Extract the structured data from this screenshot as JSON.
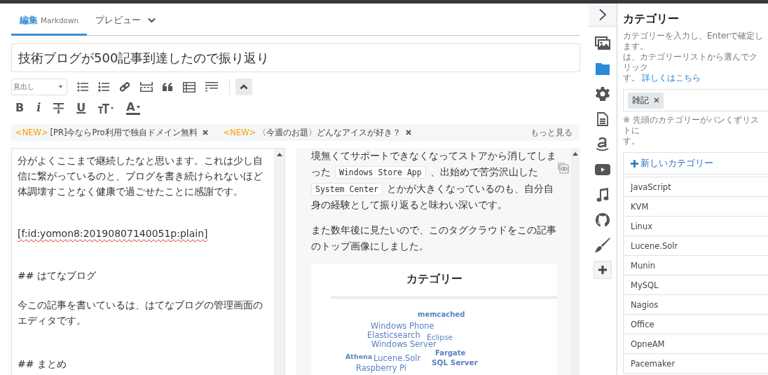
{
  "tabs": [
    {
      "label": "編集",
      "sublabel": "Markdown",
      "selected": true,
      "dropdown": false
    },
    {
      "label": "プレビュー",
      "selected": false,
      "dropdown": true
    }
  ],
  "title_field": {
    "value": "技術ブログが500記事到達したので振り返り"
  },
  "toolbar": {
    "heading_select": {
      "placeholder": "見出し"
    },
    "tools": [
      {
        "kind": "bullet-list"
      },
      {
        "kind": "number-list"
      },
      {
        "kind": "link"
      },
      {
        "kind": "page-break"
      },
      {
        "kind": "quote"
      },
      {
        "kind": "table"
      },
      {
        "kind": "more"
      }
    ],
    "format_buttons": [
      {
        "kind": "bold",
        "glyph": "B"
      },
      {
        "kind": "italic",
        "glyph": "i"
      },
      {
        "kind": "strike"
      },
      {
        "kind": "underline",
        "glyph": "U"
      },
      {
        "kind": "size"
      },
      {
        "kind": "color",
        "glyph": "A"
      }
    ]
  },
  "notices": [
    {
      "badge": "<NEW>",
      "text": "[PR]今ならPro利用で独自ドメイン無料"
    },
    {
      "badge": "<NEW>",
      "text": "〈今週のお題〉どんなアイスが好き？"
    }
  ],
  "more_link": "もっと見る",
  "editor_blocks": [
    {
      "kind": "text",
      "lines": [
        "分がよくここまで継続したなと思います。これは少し自",
        "信に繋がっているのと、ブログを書き続けられないほど",
        "体調壊すことなく健康で過ごせたことに感謝です。"
      ]
    },
    {
      "kind": "misspelled",
      "lines": [
        "[f:id:yomon8:20190807140051p:plain]"
      ]
    },
    {
      "kind": "heading",
      "lines": [
        "## はてなブログ"
      ]
    },
    {
      "kind": "text",
      "lines": [
        "今この記事を書いているは、はてなブログの管理画面の",
        "エディタです。"
      ]
    },
    {
      "kind": "heading",
      "lines": [
        "## まとめ"
      ]
    }
  ],
  "preview_paragraphs": [
    {
      "lines": [
        [
          {
            "kind": "text",
            "text": "境無くてサポートできなくなってストアから消してしま"
          }
        ],
        [
          {
            "kind": "text",
            "text": "った"
          },
          {
            "kind": "code",
            "text": "Windows Store App"
          },
          {
            "kind": "text",
            "text": "、出始めで苦労沢山した"
          }
        ],
        [
          {
            "kind": "code",
            "text": "System Center"
          },
          {
            "kind": "text",
            "text": "とかが大きくなっているのも、自分自"
          }
        ],
        [
          {
            "kind": "text",
            "text": "身の経験として振り返ると味わい深いです。"
          }
        ]
      ]
    },
    {
      "lines": [
        [
          {
            "kind": "text",
            "text": "また数年後に見たいので、このタグクラウドをこの記事"
          }
        ],
        [
          {
            "kind": "text",
            "text": "のトップ画像にしました。"
          }
        ]
      ]
    }
  ],
  "tag_cloud": {
    "title": "カテゴリー",
    "words": [
      "memcached",
      "Windows Phone",
      "Elasticsearch",
      "Eclipse",
      "Windows Server",
      "Athena",
      "Lucene.Solr",
      "Fargate",
      "SQL Server",
      "Raspberry Pi"
    ]
  },
  "side_icons": [
    {
      "kind": "image",
      "selected": false
    },
    {
      "kind": "folder",
      "selected": true
    },
    {
      "kind": "gear",
      "selected": false
    },
    {
      "kind": "document",
      "selected": false
    },
    {
      "kind": "amazon",
      "selected": false
    },
    {
      "kind": "video",
      "selected": false
    },
    {
      "kind": "music",
      "selected": false
    },
    {
      "kind": "github",
      "selected": false
    },
    {
      "kind": "brush",
      "selected": false
    }
  ],
  "category_panel": {
    "title": "カテゴリー",
    "help_lines": [
      "カテゴリーを入力し、Enterで確定します。",
      "は、カテゴリーリストから選んでクリック"
    ],
    "help_last": "す。",
    "help_link": "詳しくはこちら",
    "tags": [
      {
        "label": "雑記"
      }
    ],
    "note_lines": [
      "※ 先頭のカテゴリーがパンくずリストに",
      "す。"
    ],
    "new_category": "新しいカテゴリー",
    "categories": [
      "JavaScript",
      "KVM",
      "Linux",
      "Lucene.Solr",
      "Munin",
      "MySQL",
      "Nagios",
      "Office",
      "OpneAM",
      "Pacemaker"
    ]
  }
}
